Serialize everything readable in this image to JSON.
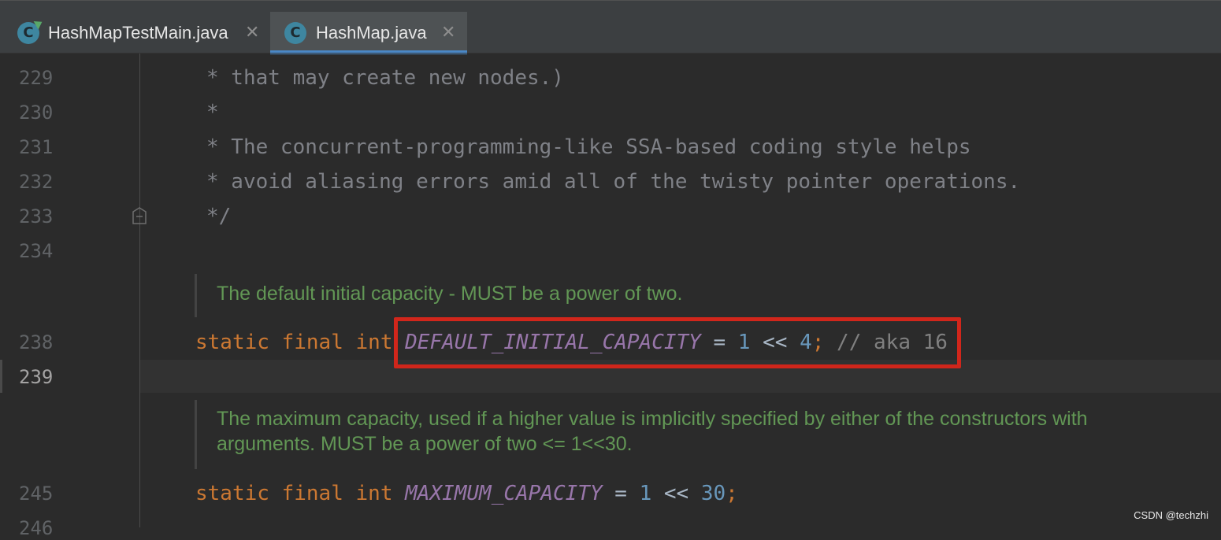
{
  "tabs": [
    {
      "label": "HashMapTestMain.java",
      "icon": "class-run-icon",
      "icon_letter": "C",
      "close": "✕"
    },
    {
      "label": "HashMap.java",
      "icon": "class-icon",
      "icon_letter": "C",
      "close": "✕",
      "active": true
    }
  ],
  "editor": {
    "lines": [
      {
        "number": "229",
        "text": "* that may create new nodes.)"
      },
      {
        "number": "230",
        "text": "*"
      },
      {
        "number": "231",
        "text": "* The concurrent-programming-like SSA-based coding style helps"
      },
      {
        "number": "232",
        "text": "* avoid aliasing errors amid all of the twisty pointer operations."
      },
      {
        "number": "233",
        "text": "*/"
      },
      {
        "number": "234",
        "text": ""
      },
      {
        "number": "238"
      },
      {
        "number": "239"
      },
      {
        "number": "245"
      },
      {
        "number": "246"
      }
    ],
    "doc1": "The default initial capacity - MUST be a power of two.",
    "doc2_line1": "The maximum capacity, used if a higher value is implicitly specified by either of the constructors with",
    "doc2_line2": "arguments. MUST be a power of two <= 1<<30.",
    "line238": {
      "kw1": "static",
      "kw2": "final",
      "kw3": "int",
      "name": "DEFAULT_INITIAL_CAPACITY",
      "eq": "=",
      "a": "1",
      "op": "<<",
      "b": "4",
      "semi": ";",
      "comment": "// aka 16"
    },
    "line245": {
      "kw1": "static",
      "kw2": "final",
      "kw3": "int",
      "name": "MAXIMUM_CAPACITY",
      "eq": "=",
      "a": "1",
      "op": "<<",
      "b": "30",
      "semi": ";"
    }
  },
  "colors": {
    "highlight_box": "#d1261b",
    "keyword": "#cc7832",
    "constant": "#9876aa",
    "number": "#6897bb",
    "doc": "#629755"
  },
  "watermark": "CSDN @techzhi"
}
